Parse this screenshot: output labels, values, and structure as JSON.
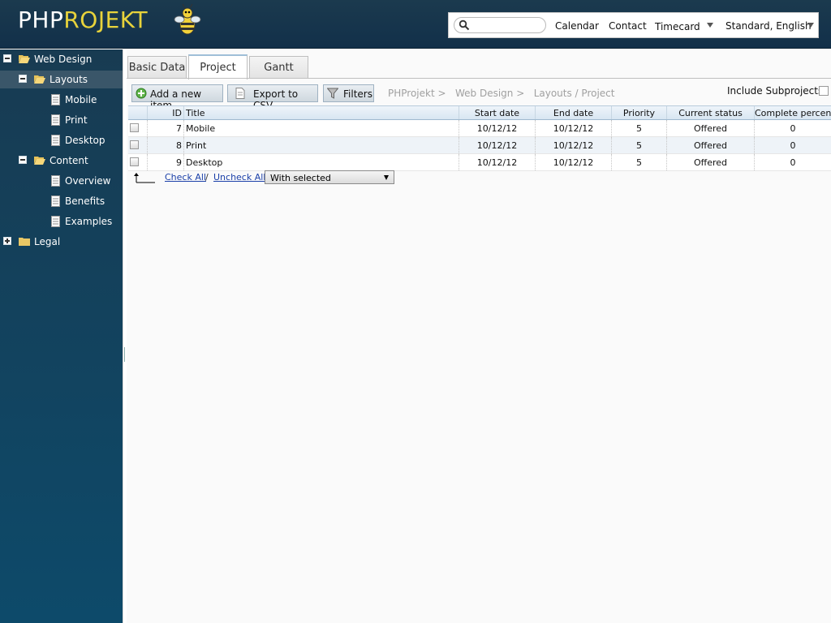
{
  "app": {
    "logo_php": "PHP",
    "logo_projekt": "ROJEKT"
  },
  "topbar": {
    "search_placeholder": "",
    "nav": [
      "Calendar",
      "Contact",
      "Timecard"
    ],
    "language": "Standard, English"
  },
  "sidebar": {
    "items": [
      {
        "label": "Web Design"
      },
      {
        "label": "Layouts"
      },
      {
        "label": "Mobile"
      },
      {
        "label": "Print"
      },
      {
        "label": "Desktop"
      },
      {
        "label": "Content"
      },
      {
        "label": "Overview"
      },
      {
        "label": "Benefits"
      },
      {
        "label": "Examples"
      },
      {
        "label": "Legal"
      }
    ]
  },
  "tabs": [
    {
      "label": "Basic Data"
    },
    {
      "label": "Project"
    },
    {
      "label": "Gantt"
    }
  ],
  "toolbar": {
    "add_label": "Add a new item",
    "export_label": "Export to CSV",
    "filters_label": "Filters"
  },
  "breadcrumb": "PHProjekt >   Web Design >   Layouts / Project",
  "subprojects_label": "Include Subprojects",
  "grid": {
    "headers": [
      "ID",
      "Title",
      "Start date",
      "End date",
      "Priority",
      "Current status",
      "Complete percent"
    ],
    "rows": [
      [
        "7",
        "Mobile",
        "10/12/12",
        "10/12/12",
        "5",
        "Offered",
        "0"
      ],
      [
        "8",
        "Print",
        "10/12/12",
        "10/12/12",
        "5",
        "Offered",
        "0"
      ],
      [
        "9",
        "Desktop",
        "10/12/12",
        "10/12/12",
        "5",
        "Offered",
        "0"
      ]
    ]
  },
  "footer": {
    "check_all": "Check All",
    "slash": "/",
    "uncheck_all": "Uncheck All",
    "with_selected": "With selected"
  },
  "colors": {
    "header_bg": "#12304a",
    "logo_accent": "#e8d33b",
    "sidebar_bg": "#0d4a6a",
    "link": "#1a3fa8"
  }
}
